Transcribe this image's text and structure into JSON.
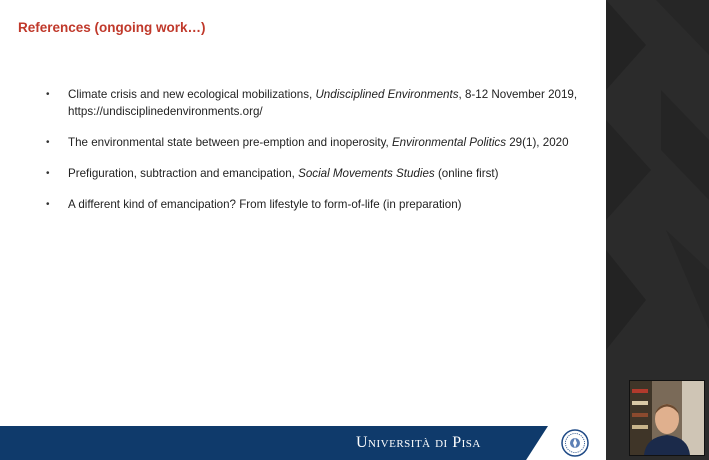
{
  "slide": {
    "title": "References (ongoing work…)",
    "references": [
      {
        "pre": "Climate crisis and new ecological mobilizations, ",
        "em": "Undisciplined Environments",
        "post": ", 8-12 November 2019, https://undisciplinedenvironments.org/"
      },
      {
        "pre": "The environmental state between pre-emption and inoperosity, ",
        "em": "Environmental Politics",
        "post": " 29(1), 2020"
      },
      {
        "pre": "Prefiguration, subtraction and emancipation, ",
        "em": "Social Movements Studies",
        "post": " (online first)"
      },
      {
        "pre": "A different kind of emancipation? From lifestyle to form-of-life (in preparation)",
        "em": "",
        "post": ""
      }
    ],
    "bullet": "•"
  },
  "footer": {
    "university": "Università di Pisa",
    "band_color": "#0f3a6b"
  },
  "icons": {
    "seal": "university-seal-icon"
  },
  "colors": {
    "title": "#c0392b",
    "panel": "#2d2d2d"
  }
}
